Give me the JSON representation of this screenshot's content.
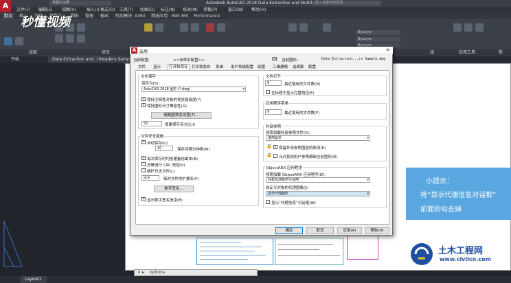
{
  "window": {
    "app_icon": "A",
    "title": "Autodesk AutoCAD 2018    Data Extraction and Multileaders Sample.dwg",
    "quick_access": "草图与注释",
    "search_placeholder": "键入关键字或短语"
  },
  "menubar": [
    "文件(F)",
    "编辑(E)",
    "视图(V)",
    "插入(I)",
    "格式(O)",
    "工具(T)",
    "绘图(D)",
    "标注(N)",
    "修改(M)",
    "参数(P)",
    "窗口(W)",
    "帮助(H)"
  ],
  "ribbon_tabs": [
    {
      "label": "默认",
      "active": true
    },
    {
      "label": "插入"
    },
    {
      "label": "注释"
    },
    {
      "label": "参数化"
    },
    {
      "label": "视图"
    },
    {
      "label": "管理"
    },
    {
      "label": "输出"
    },
    {
      "label": "附加模块"
    },
    {
      "label": "A360"
    },
    {
      "label": "精选应用"
    },
    {
      "label": "BIM 360"
    },
    {
      "label": "Performance"
    }
  ],
  "ribbon_panels": [
    "绘图",
    "修改",
    "图层",
    "块",
    "特性",
    "组",
    "实用工具",
    "剪"
  ],
  "layer_props": {
    "bylayer1": "ByLayer",
    "bylayer2": "ByLayer",
    "bylayer3": "ByLayer"
  },
  "file_tabs": [
    {
      "label": "开始"
    },
    {
      "label": "Data Extraction and...ltileaders Sample*",
      "active": true
    },
    {
      "label": "+"
    }
  ],
  "brand_logo": "秒懂视频",
  "command_line": {
    "prompt": "options"
  },
  "layout_tab": "Layout1",
  "tip": {
    "title": "小提示：",
    "line1": "将“显示代理信息对话框”",
    "line2": "前面的勾去掉"
  },
  "watermark": {
    "name": "土木工程网",
    "url": "www.civilcn.com"
  },
  "dialog": {
    "title": "选项",
    "close": "✕",
    "current_profile_label": "当前配置:",
    "current_profile_value": "<<未命名配置>>",
    "current_drawing_label": "当前图形:",
    "current_drawing_value": "Data Extraction...rs Sample.dwg",
    "tabs": [
      "文件",
      "显示",
      "打开和保存",
      "打印和发布",
      "系统",
      "用户系统配置",
      "绘图",
      "三维建模",
      "选择集",
      "配置"
    ],
    "active_tab": 2,
    "file_save": {
      "group": "文件保存",
      "save_as_label": "另存为(S):",
      "save_as_value": "AutoCAD 2018 图形 (*.dwg)",
      "cb_keep_annot": "保持注释性对象的视觉逼真度(Y)",
      "cb_keep_size": "保持图形尺寸兼容性(G)",
      "thumb_button": "缩略图预览设置(T)...",
      "incr_value": "50",
      "incr_label": "增量保存百分比(I)"
    },
    "file_safety": {
      "group": "文件安全措施",
      "cb_autosave": "自动保存(U)",
      "autosave_value": "10",
      "autosave_label": "保存间隔分钟数(M)",
      "cb_backup": "每次保存时均创建备份副本(B)",
      "cb_crc": "总是进行 CRC 校验(V)",
      "cb_log": "维护日志文件(L)",
      "ext_value": "ac$",
      "ext_label": "临时文件的扩展名(P)",
      "digsig_button": "数字签名...",
      "cb_digsig": "显示数字签名信息(E)"
    },
    "file_open": {
      "group": "文件打开",
      "recent_value": "9",
      "recent_label": "最近使用的文件数(N)",
      "cb_fullpath": "在标题中显示完整路径(F)"
    },
    "app_menu": {
      "group": "应用程序菜单",
      "recent_value": "9",
      "recent_label": "最近使用的文件数(F)"
    },
    "xref": {
      "group": "外部参照",
      "demand_label": "按需加载外部参照文件(X):",
      "demand_value": "使用副本",
      "cb_retain": "保留外部参照图层的修改(R)",
      "cb_allow": "允许其他用户参照编辑当前图形(D)"
    },
    "objectarx": {
      "group": "ObjectARX 应用程序",
      "load_label": "按需加载 ObjectARX 应用程序(D):",
      "load_value": "对象检测和命令调用",
      "proxy_label": "自定义对象的代理图像(J):",
      "proxy_value": "显示代理图形",
      "cb_proxy_info": "显示“代理信息”对话框(W)"
    },
    "buttons": {
      "ok": "确定",
      "cancel": "取消",
      "apply": "应用(A)",
      "help": "帮助(H)"
    }
  }
}
